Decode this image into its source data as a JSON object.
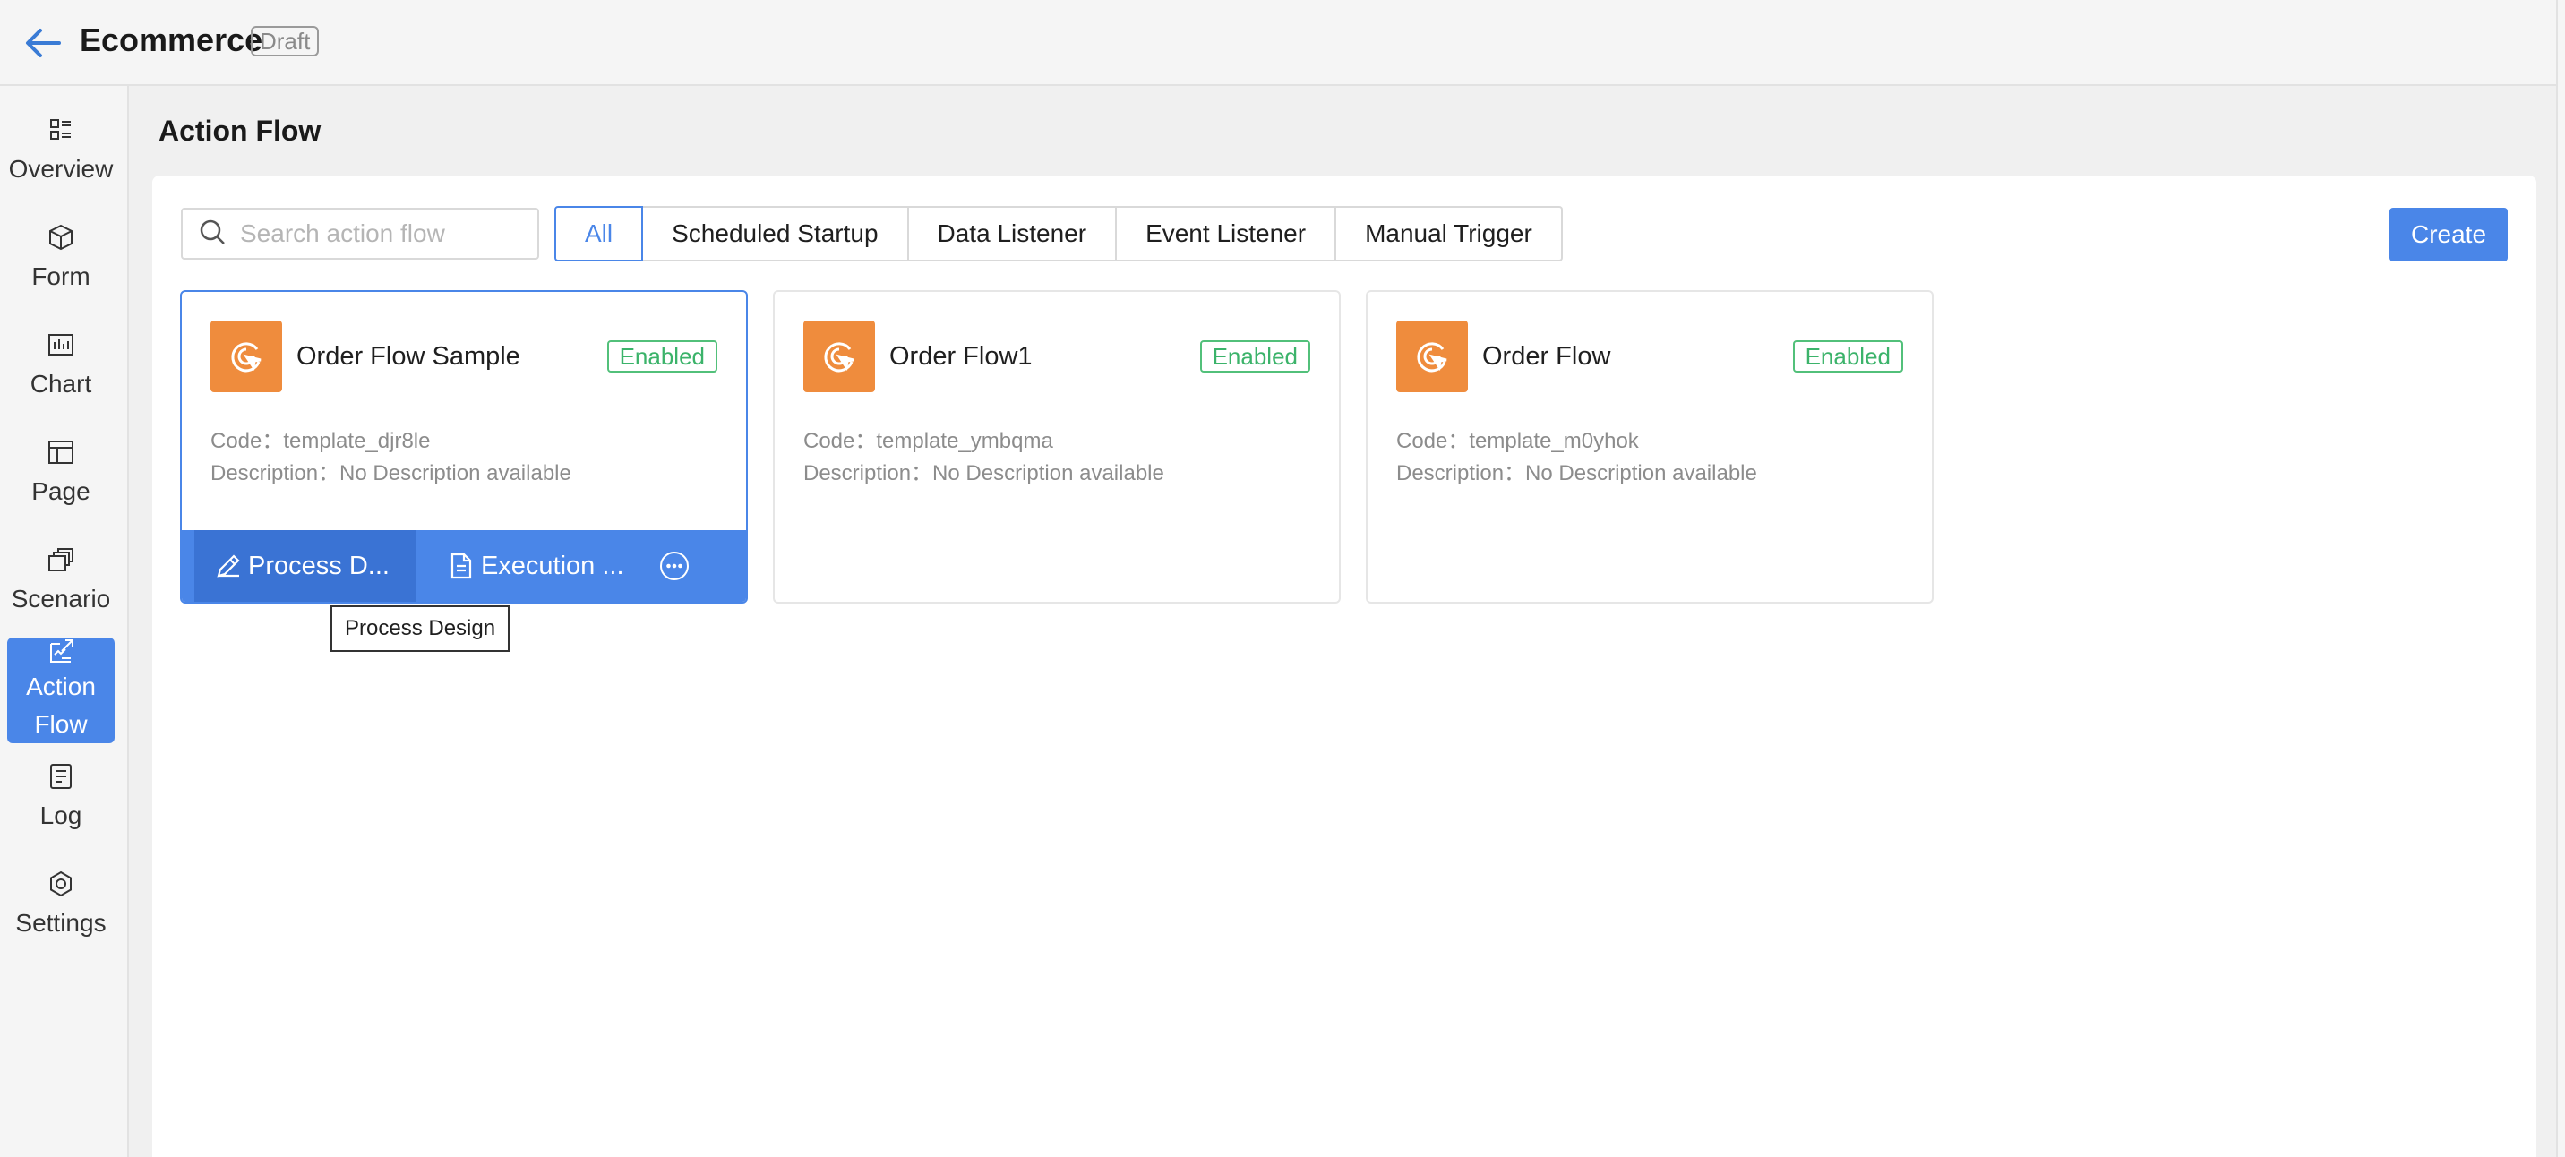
{
  "header": {
    "title": "Ecommerce",
    "badge": "Draft"
  },
  "sidebar": {
    "items": [
      {
        "label": "Overview",
        "icon": "grid-icon"
      },
      {
        "label": "Form",
        "icon": "cube-icon"
      },
      {
        "label": "Chart",
        "icon": "chart-icon"
      },
      {
        "label": "Page",
        "icon": "page-icon"
      },
      {
        "label": "Scenario",
        "icon": "stack-icon"
      },
      {
        "label": "Action Flow",
        "icon": "flow-icon",
        "active": true
      },
      {
        "label": "Log",
        "icon": "log-icon"
      },
      {
        "label": "Settings",
        "icon": "gear-icon"
      }
    ]
  },
  "page": {
    "title": "Action Flow"
  },
  "search": {
    "placeholder": "Search action flow",
    "value": ""
  },
  "filters": {
    "tabs": [
      "All",
      "Scheduled Startup",
      "Data Listener",
      "Event Listener",
      "Manual Trigger"
    ],
    "active": "All"
  },
  "toolbar": {
    "create_label": "Create"
  },
  "cards": [
    {
      "title": "Order Flow Sample",
      "status": "Enabled",
      "code": "Code：template_djr8le",
      "description": "Description：No Description available"
    },
    {
      "title": "Order Flow1",
      "status": "Enabled",
      "code": "Code：template_ymbqma",
      "description": "Description：No Description available"
    },
    {
      "title": "Order Flow",
      "status": "Enabled",
      "code": "Code：template_m0yhok",
      "description": "Description：No Description available"
    }
  ],
  "card_actions": {
    "process_design": "Process D...",
    "execution": "Execution ..."
  },
  "tooltip": {
    "text": "Process Design"
  },
  "colors": {
    "accent": "#4a86e8",
    "card_icon": "#ef8c3d",
    "enabled": "#3bb36a"
  }
}
